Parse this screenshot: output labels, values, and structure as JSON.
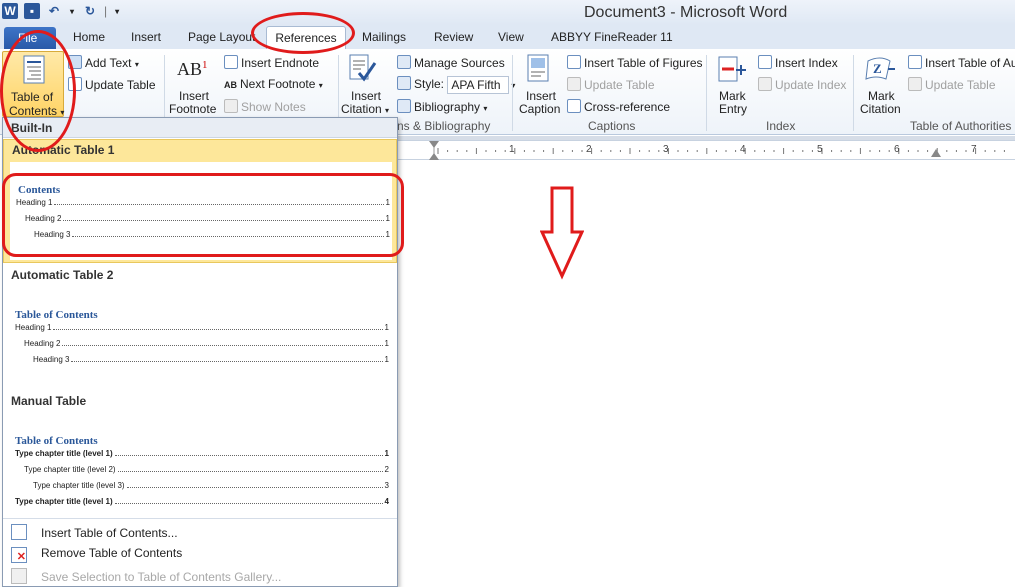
{
  "title_bar": {
    "window_title": "Document3  -  Microsoft Word",
    "qat_separator": "|"
  },
  "tabs": [
    {
      "label": "File"
    },
    {
      "label": "Home"
    },
    {
      "label": "Insert"
    },
    {
      "label": "Page Layout"
    },
    {
      "label": "References"
    },
    {
      "label": "Mailings"
    },
    {
      "label": "Review"
    },
    {
      "label": "View"
    },
    {
      "label": "ABBYY FineReader 11"
    }
  ],
  "ribbon": {
    "toc": {
      "label_line1": "Table of",
      "label_line2": "Contents",
      "add_text": "Add Text",
      "update_table": "Update Table"
    },
    "footnotes": {
      "insert_footnote_line1": "Insert",
      "insert_footnote_line2": "Footnote",
      "insert_footnote_icon_text": "AB",
      "insert_footnote_sup": "1",
      "insert_endnote": "Insert Endnote",
      "next_footnote": "Next Footnote",
      "next_footnote_icon_text": "AB",
      "show_notes": "Show Notes"
    },
    "citations": {
      "insert_citation_line1": "Insert",
      "insert_citation_line2": "Citation",
      "manage_sources": "Manage Sources",
      "style_label": "Style:",
      "style_value": "APA Fifth",
      "bibliography": "Bibliography",
      "group_label": "ns & Bibliography"
    },
    "captions": {
      "insert_caption_line1": "Insert",
      "insert_caption_line2": "Caption",
      "insert_table_of_figures": "Insert Table of Figures",
      "update_table": "Update Table",
      "cross_reference": "Cross-reference",
      "group_label": "Captions"
    },
    "index": {
      "mark_entry_line1": "Mark",
      "mark_entry_line2": "Entry",
      "insert_index": "Insert Index",
      "update_index": "Update Index",
      "group_label": "Index"
    },
    "authorities": {
      "mark_citation_line1": "Mark",
      "mark_citation_line2": "Citation",
      "insert_table_of_authorities": "Insert Table of Au",
      "update_table": "Update Table",
      "group_label": "Table of Authorities"
    }
  },
  "ruler": {
    "numbers": [
      "1",
      "2",
      "3",
      "4",
      "5",
      "6",
      "7"
    ]
  },
  "dropdown": {
    "section_header": "Built-In",
    "auto1": {
      "title": "Automatic Table 1",
      "heading": "Contents",
      "lines": [
        {
          "text": "Heading 1",
          "page": "1"
        },
        {
          "text": "Heading 2",
          "page": "1"
        },
        {
          "text": "Heading 3",
          "page": "1"
        }
      ]
    },
    "auto2": {
      "title": "Automatic Table 2",
      "heading": "Table of Contents",
      "lines": [
        {
          "text": "Heading 1",
          "page": "1"
        },
        {
          "text": "Heading 2",
          "page": "1"
        },
        {
          "text": "Heading 3",
          "page": "1"
        }
      ]
    },
    "manual": {
      "title": "Manual Table",
      "heading": "Table of Contents",
      "lines": [
        {
          "text": "Type chapter title (level 1)",
          "page": "1"
        },
        {
          "text": "Type chapter title (level 2)",
          "page": "2"
        },
        {
          "text": "Type chapter title (level 3)",
          "page": "3"
        },
        {
          "text": "Type chapter title (level 1)",
          "page": "4"
        }
      ]
    },
    "commands": {
      "insert": "Insert Table of Contents...",
      "remove": "Remove Table of Contents",
      "save_selection": "Save Selection to Table of Contents Gallery..."
    }
  },
  "annotations": {
    "arrow": "⇩"
  }
}
